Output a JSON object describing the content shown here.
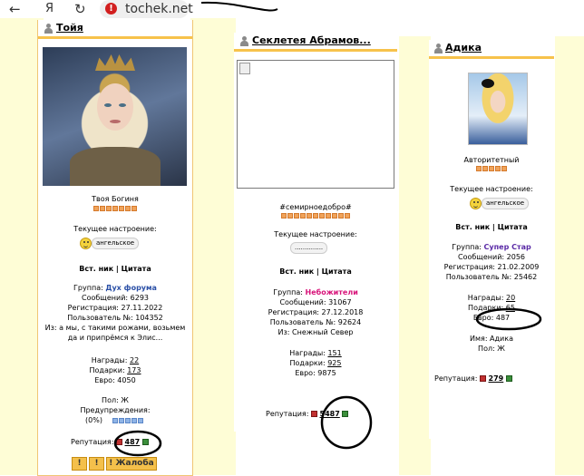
{
  "browser": {
    "back": "←",
    "ya": "Я",
    "reload": "↻",
    "warn": "!",
    "url": "tochek.net"
  },
  "colors": {
    "accent": "#f7c24b",
    "background": "#fefdd6",
    "group_blue": "#2a4fa6",
    "group_red": "#d8147a"
  },
  "profile1": {
    "name": "Тойя",
    "status": "Твоя Богиня",
    "mood_label": "Текущее настроение:",
    "mood": "ангельское",
    "links": "Вст. ник | Цитата",
    "group_label": "Группа:",
    "group": "Дух форума",
    "messages": "Сообщений: 6293",
    "registration": "Регистрация: 27.11.2022",
    "user_no": "Пользователь №: 104352",
    "from_line1": "Из: а мы, с такими рожами, возьмем",
    "from_line2": "да и припрёмся к Элис...",
    "awards_label": "Награды:",
    "awards": "22",
    "gifts_label": "Подарки:",
    "gifts": "173",
    "euro": "Евро: 4050",
    "gender": "Пол: Ж",
    "warnings_label": "Предупреждения:",
    "warnings": "(0%)",
    "rep_label": "Репутация:",
    "rep": "487",
    "buttons": [
      "!",
      "!",
      "! Жалоба"
    ]
  },
  "profile2": {
    "name": "Секлетея Абрамов...",
    "status": "#семирноедобро#",
    "mood_label": "Текущее настроение:",
    "mood": "..............",
    "links": "Вст. ник | Цитата",
    "group_label": "Группа:",
    "group": "Небожители",
    "messages": "Сообщений: 31067",
    "registration": "Регистрация: 27.12.2018",
    "user_no": "Пользователь №: 92624",
    "from": "Из: Снежный Север",
    "awards_label": "Награды:",
    "awards": "151",
    "gifts_label": "Подарки:",
    "gifts": "925",
    "euro": "Евро: 9875",
    "rep_label": "Репутация:",
    "rep": "5487"
  },
  "profile3": {
    "name": "Адика",
    "status": "Авторитетный",
    "mood_label": "Текущее настроение:",
    "mood": "ангельское",
    "links": "Вст. ник | Цитата",
    "group_label": "Группа:",
    "group": "Супер Стар",
    "messages": "Сообщений: 2056",
    "registration": "Регистрация: 21.02.2009",
    "user_no": "Пользователь №: 25462",
    "awards_label": "Награды:",
    "awards": "20",
    "gifts_label": "Подарки:",
    "gifts": "65",
    "euro": "Евро: 487",
    "name_line": "Имя: Адика",
    "gender": "Пол: Ж",
    "rep_label": "Репутация:",
    "rep": "279"
  }
}
